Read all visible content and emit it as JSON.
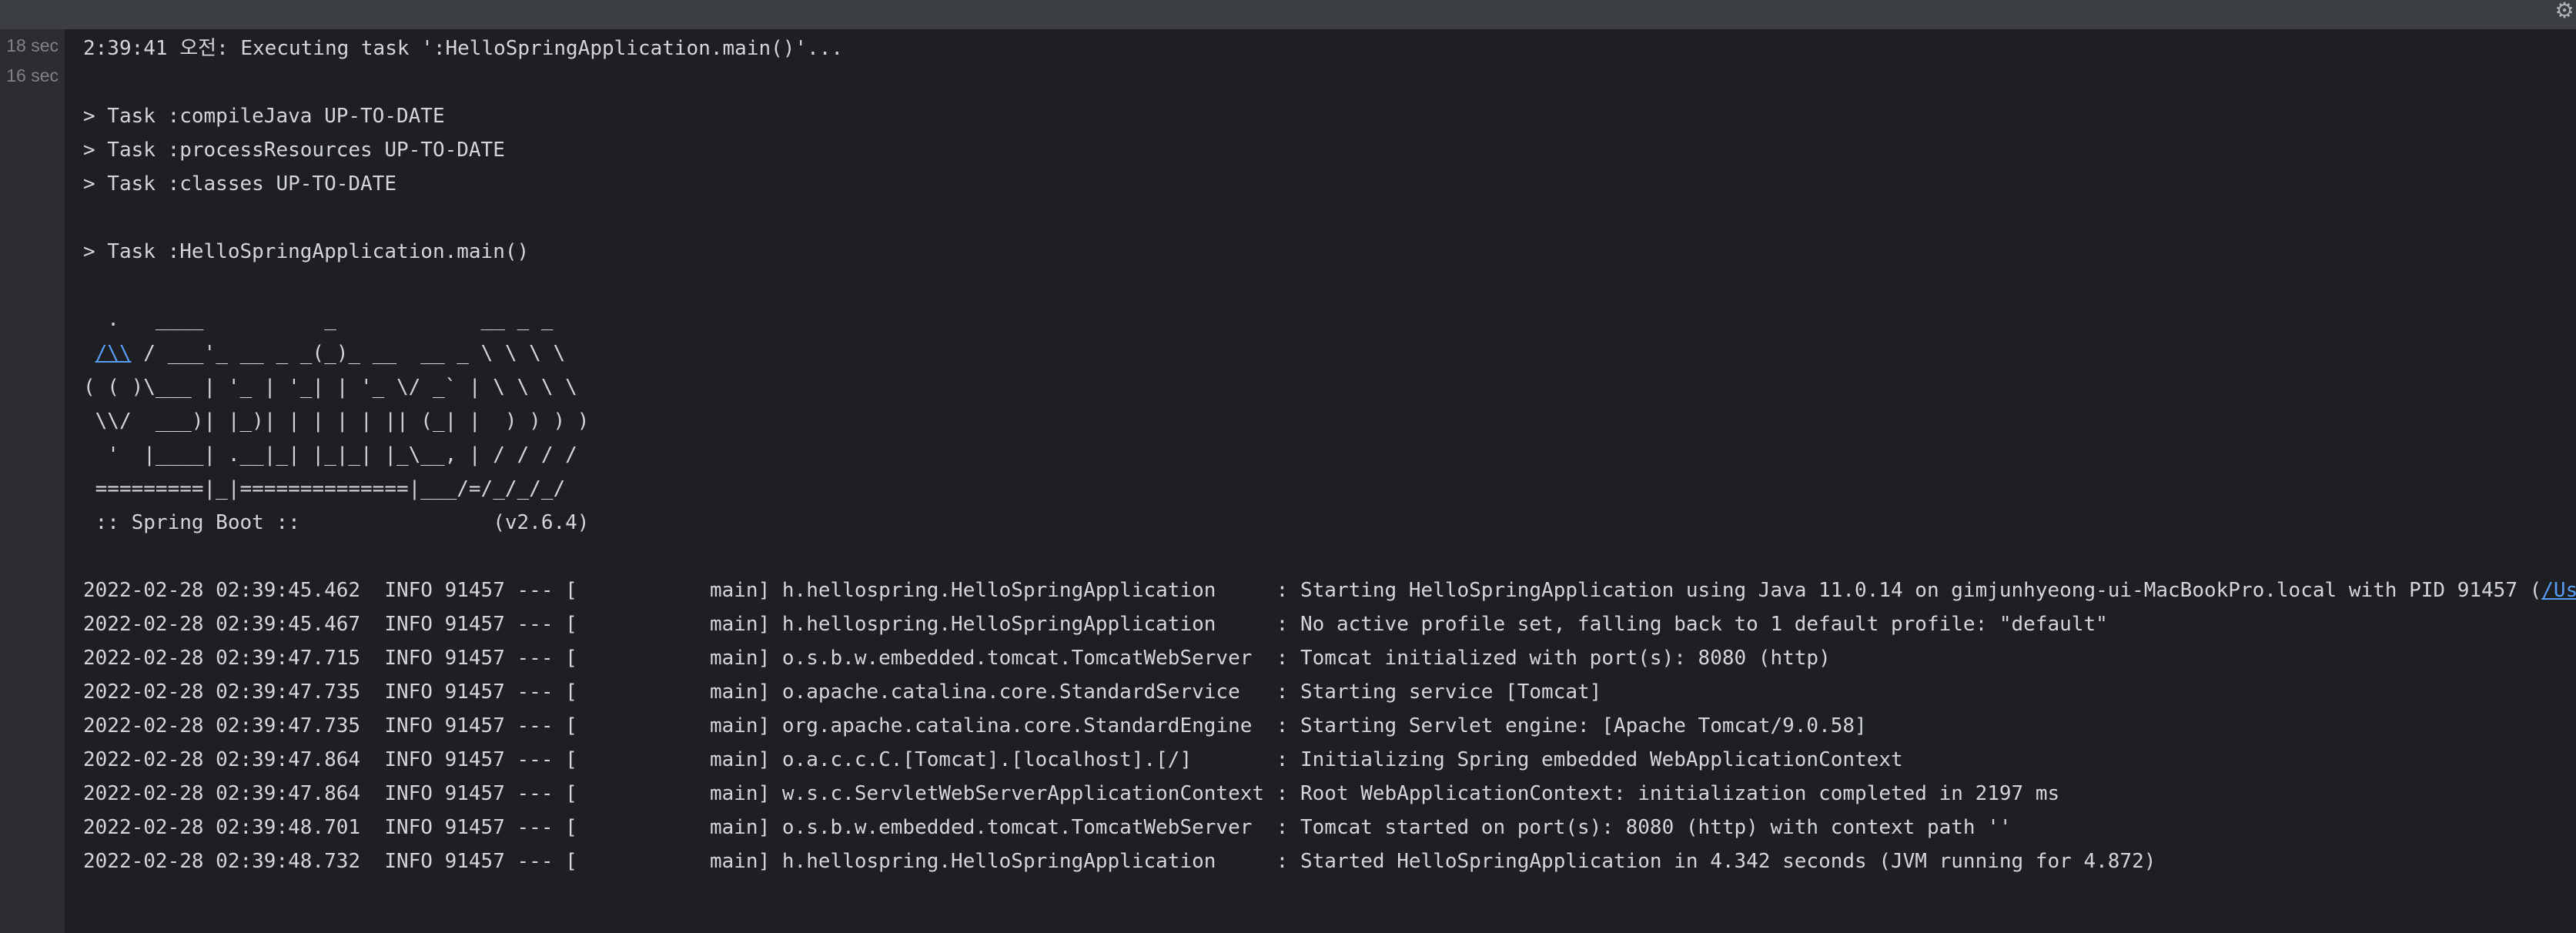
{
  "timings": [
    "18 sec",
    "16 sec"
  ],
  "gear_glyph": "⚙",
  "console": {
    "lines": [
      "2:39:41 오전: Executing task ':HelloSpringApplication.main()'...",
      "",
      "> Task :compileJava UP-TO-DATE",
      "> Task :processResources UP-TO-DATE",
      "> Task :classes UP-TO-DATE",
      "",
      "> Task :HelloSpringApplication.main()",
      "",
      "  .   ____          _            __ _ _",
      "",
      "( ( )\\___ | '_ | '_| | '_ \\/ _` | \\ \\ \\ \\",
      " \\\\/  ___)| |_)| | | | | || (_| |  ) ) ) )",
      "  '  |____| .__|_| |_|_| |_\\__, | / / / /",
      " =========|_|==============|___/=/_/_/_/",
      " :: Spring Boot ::                (v2.6.4)",
      "",
      "2022-02-28 02:39:45.462  INFO 91457 --- [           main] h.hellospring.HelloSpringApplication     : Starting HelloSpringApplication using Java 11.0.14 on gimjunhyeong-ui-MacBookPro.local with PID 91457 (",
      "2022-02-28 02:39:45.467  INFO 91457 --- [           main] h.hellospring.HelloSpringApplication     : No active profile set, falling back to 1 default profile: \"default\"",
      "2022-02-28 02:39:47.715  INFO 91457 --- [           main] o.s.b.w.embedded.tomcat.TomcatWebServer  : Tomcat initialized with port(s): 8080 (http)",
      "2022-02-28 02:39:47.735  INFO 91457 --- [           main] o.apache.catalina.core.StandardService   : Starting service [Tomcat]",
      "2022-02-28 02:39:47.735  INFO 91457 --- [           main] org.apache.catalina.core.StandardEngine  : Starting Servlet engine: [Apache Tomcat/9.0.58]",
      "2022-02-28 02:39:47.864  INFO 91457 --- [           main] o.a.c.c.C.[Tomcat].[localhost].[/]       : Initializing Spring embedded WebApplicationContext",
      "2022-02-28 02:39:47.864  INFO 91457 --- [           main] w.s.c.ServletWebServerApplicationContext : Root WebApplicationContext: initialization completed in 2197 ms",
      "2022-02-28 02:39:48.701  INFO 91457 --- [           main] o.s.b.w.embedded.tomcat.TomcatWebServer  : Tomcat started on port(s): 8080 (http) with context path ''",
      "2022-02-28 02:39:48.732  INFO 91457 --- [           main] h.hellospring.HelloSpringApplication     : Started HelloSpringApplication in 4.342 seconds (JVM running for 4.872)"
    ],
    "banner_link": "/\\\\",
    "banner_line_rest": " / ___'_ __ _ _(_)_ __  __ _ \\ \\ \\ \\",
    "log_path_link": "/Us"
  }
}
